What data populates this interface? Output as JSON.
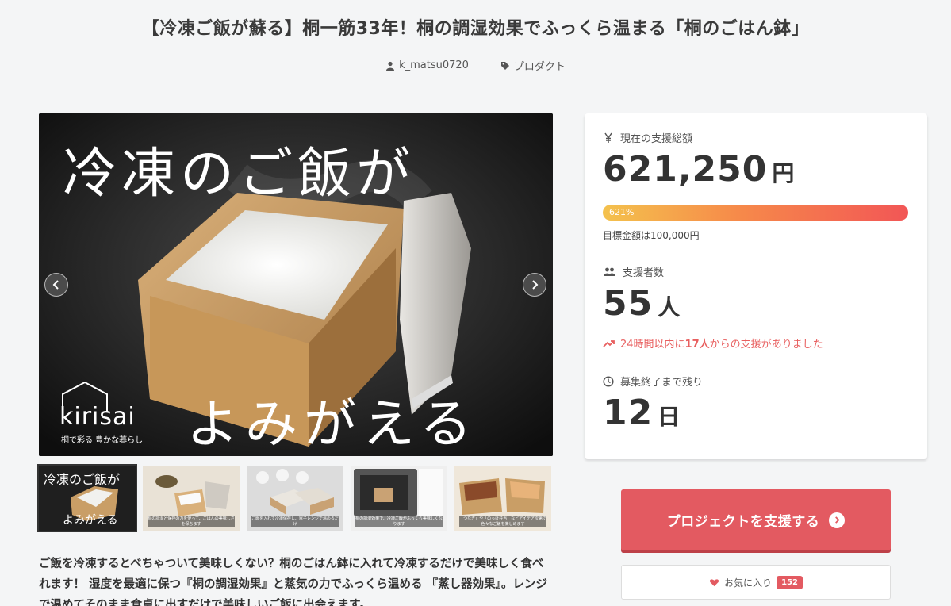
{
  "page": {
    "title": "【冷凍ご飯が蘇る】桐一筋33年！桐の調湿効果でふっくら温まる「桐のごはん鉢」",
    "author": "k_matsu0720",
    "category": "プロダクト"
  },
  "hero": {
    "headline": "冷凍のご飯が",
    "subline": "よみがえる",
    "brand_name": "kirisai",
    "brand_tagline": "桐で彩る 豊かな暮らし"
  },
  "thumbnails": [
    {
      "top": "冷凍のご飯が",
      "bottom": "よみがえる",
      "caption": ""
    },
    {
      "caption": "桐の調湿と保存の力を使って、ごはんの美味しさを保ちます"
    },
    {
      "caption": "ご飯を入れて冷凍保存し、電子レンジで温めるだけ"
    },
    {
      "caption": "桐の調湿効果で、冷凍ご飯がふっくら美味しくなります"
    },
    {
      "caption": "「つなぎ」や「のっけ弁当」などアイデア次第で色々なご飯を楽しめます"
    }
  ],
  "description": "ご飯を冷凍するとべちゃついて美味しくない？桐のごはん鉢に入れて冷凍するだけで美味しく食べれます！ 湿度を最適に保つ『桐の調湿効果』と蒸気の力でふっくら温める 『蒸し器効果』。レンジで温めてそのまま食卓に出すだけで美味しいご飯に出会えます。",
  "funding": {
    "total_label": "現在の支援総額",
    "total_amount": "621,250",
    "currency_unit": "円",
    "progress_percent_label": "621%",
    "progress_fraction": 1.0,
    "goal_text": "目標金額は100,000円",
    "backers_label": "支援者数",
    "backers_count": "55",
    "backers_unit": "人",
    "trend_prefix": "24時間以内に",
    "trend_count": "17人",
    "trend_suffix": "からの支援がありました",
    "remaining_label": "募集終了まで残り",
    "remaining_days": "12",
    "remaining_unit": "日"
  },
  "actions": {
    "support_label": "プロジェクトを支援する",
    "favorite_label": "お気に入り",
    "favorite_count": "152"
  },
  "colors": {
    "accent": "#e35a61",
    "trend": "#e85f5f",
    "progress_start": "#f4c24d",
    "progress_end": "#f25656"
  }
}
